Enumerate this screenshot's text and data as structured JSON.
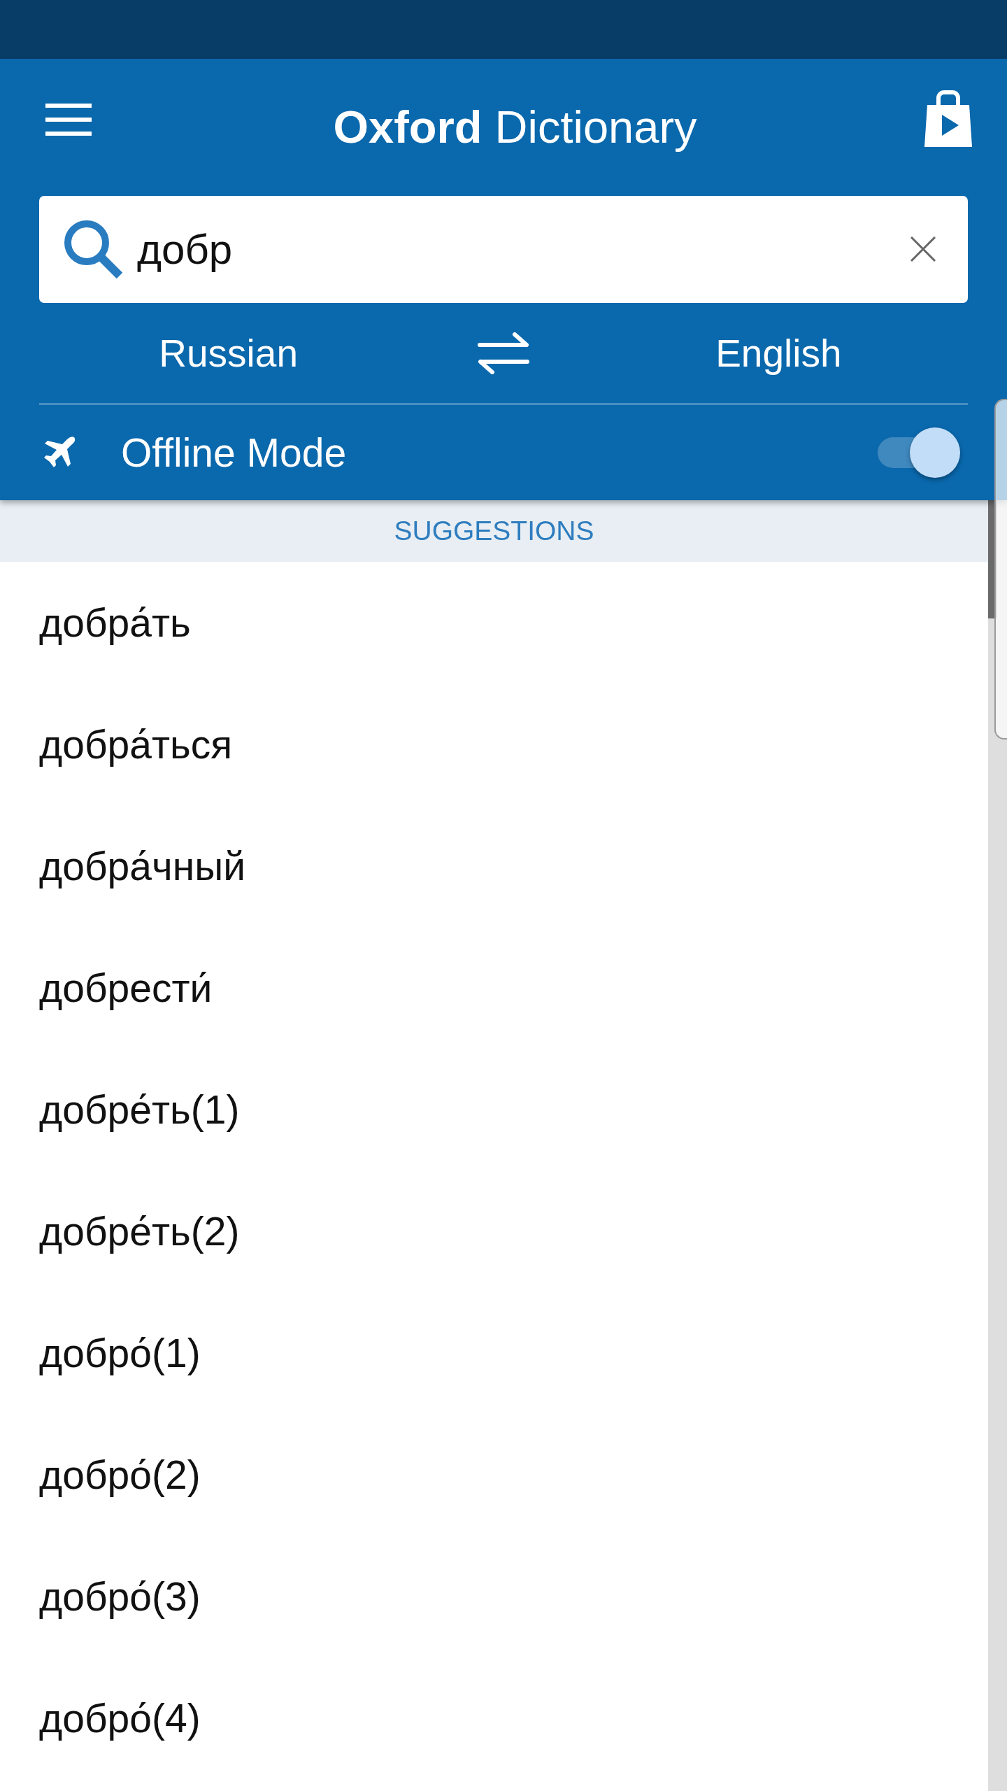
{
  "app_bar": {
    "title": "**Oxford** Dictionary"
  },
  "search": {
    "value": "добр"
  },
  "languages": {
    "source": "Russian",
    "target": "English"
  },
  "offline_mode": {
    "label": "Offline Mode",
    "on": true
  },
  "suggestions": {
    "heading": "SUGGESTIONS",
    "items": [
      "добра́ть",
      "добра́ться",
      "добра́чный",
      "добрести́",
      "добре́ть(1)",
      "добре́ть(2)",
      "добро́(1)",
      "добро́(2)",
      "добро́(3)",
      "добро́(4)"
    ]
  }
}
